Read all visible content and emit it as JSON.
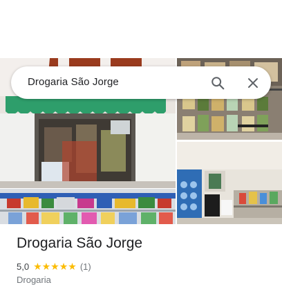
{
  "search": {
    "value": "Drogaria São Jorge"
  },
  "icons": {
    "search": "search-icon",
    "close": "close-icon",
    "star": "star-icon"
  },
  "place": {
    "name": "Drogaria São Jorge",
    "rating": "5,0",
    "stars": "★★★★★",
    "review_count": "(1)",
    "category": "Drogaria"
  },
  "colors": {
    "star": "#fbbc04",
    "awning": "#2e9e6b",
    "storefront_sign": "#9a3b1e"
  }
}
